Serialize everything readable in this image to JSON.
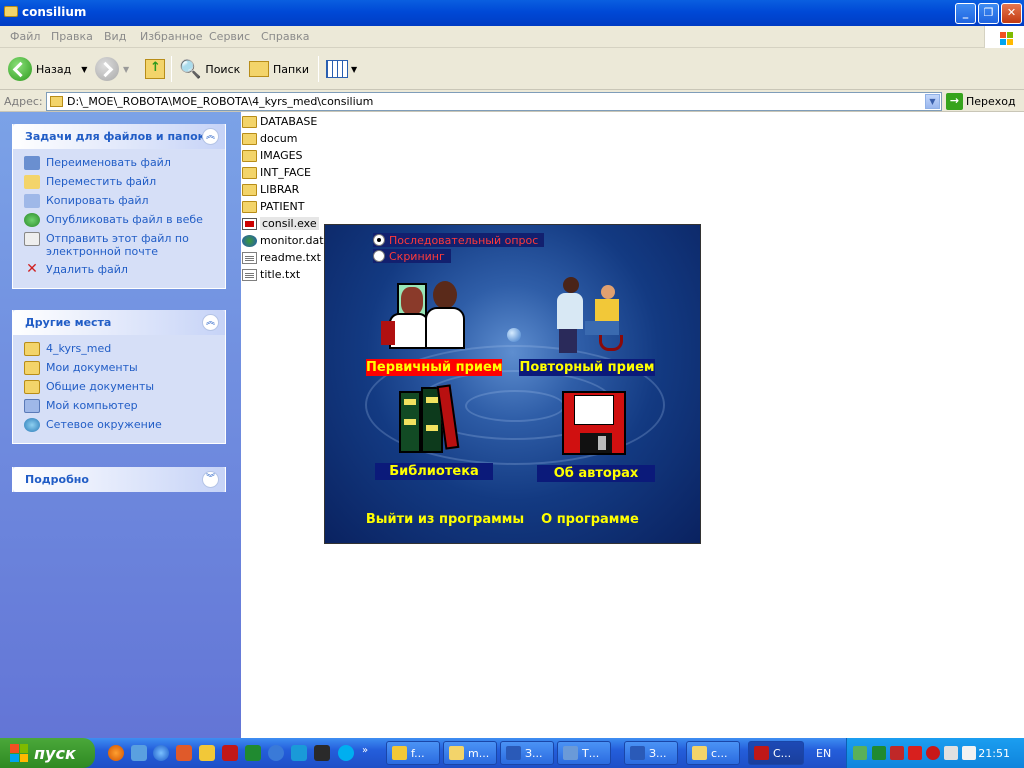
{
  "window": {
    "title": "consilium"
  },
  "menu": [
    "Файл",
    "Правка",
    "Вид",
    "Избранное",
    "Сервис",
    "Справка"
  ],
  "toolbar": {
    "back": "Назад",
    "search": "Поиск",
    "folders": "Папки"
  },
  "address": {
    "label": "Адрес:",
    "value": "D:\\_MOE\\_ROBOTA\\MOE_ROBOTA\\4_kyrs_med\\consilium",
    "go": "Переход"
  },
  "tasks": {
    "title": "Задачи для файлов и папок",
    "items": [
      {
        "label": "Переименовать файл",
        "icon": "rename-icon"
      },
      {
        "label": "Переместить файл",
        "icon": "move-icon"
      },
      {
        "label": "Копировать файл",
        "icon": "copy-icon"
      },
      {
        "label": "Опубликовать файл в вебе",
        "icon": "globe-icon"
      },
      {
        "label": "Отправить этот файл по электронной почте",
        "icon": "mail-icon"
      },
      {
        "label": "Удалить файл",
        "icon": "delete-icon"
      }
    ]
  },
  "places": {
    "title": "Другие места",
    "items": [
      {
        "label": "4_kyrs_med",
        "icon": "folder-icon"
      },
      {
        "label": "Мои документы",
        "icon": "folder-icon"
      },
      {
        "label": "Общие документы",
        "icon": "folder-icon"
      },
      {
        "label": "Мой компьютер",
        "icon": "computer-icon"
      },
      {
        "label": "Сетевое окружение",
        "icon": "network-icon"
      }
    ]
  },
  "details": {
    "title": "Подробно"
  },
  "files": [
    {
      "name": "DATABASE",
      "type": "folder"
    },
    {
      "name": "docum",
      "type": "folder"
    },
    {
      "name": "IMAGES",
      "type": "folder"
    },
    {
      "name": "INT_FACE",
      "type": "folder"
    },
    {
      "name": "LIBRAR",
      "type": "folder"
    },
    {
      "name": "PATIENT",
      "type": "folder"
    },
    {
      "name": "consil.exe",
      "type": "exe"
    },
    {
      "name": "monitor.dat",
      "type": "dat"
    },
    {
      "name": "readme.txt",
      "type": "txt"
    },
    {
      "name": "title.txt",
      "type": "txt"
    }
  ],
  "app": {
    "radio1": "Последовательный опрос",
    "radio2": "Скрининг",
    "primary": "Первичный прием",
    "repeat": "Повторный прием",
    "library": "Библиотека",
    "authors": "Об авторах",
    "exit": "Выйти из программы",
    "about": "О программе"
  },
  "taskbar": {
    "start": "пуск",
    "tasks": [
      {
        "label": "f...",
        "icon": "web-icon"
      },
      {
        "label": "m...",
        "icon": "folder-icon"
      },
      {
        "label": "З...",
        "icon": "word-icon"
      },
      {
        "label": "Т...",
        "icon": "app-icon"
      },
      {
        "label": "З...",
        "icon": "word-icon"
      },
      {
        "label": "c...",
        "icon": "folder-icon"
      },
      {
        "label": "C...",
        "icon": "exe-icon"
      }
    ],
    "lang": "EN",
    "clock": "21:51"
  }
}
